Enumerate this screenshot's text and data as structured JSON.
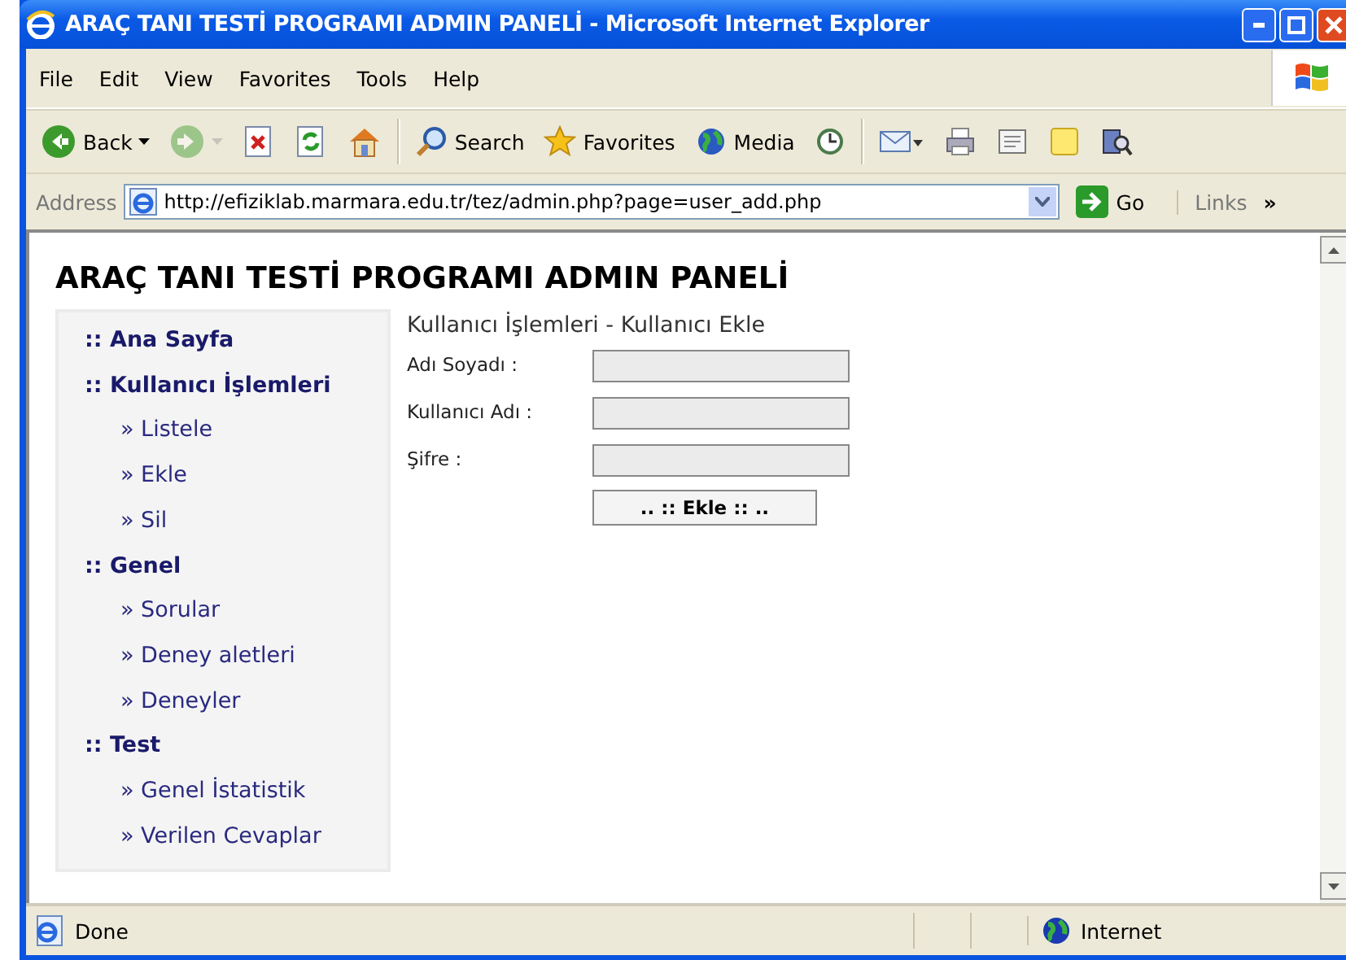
{
  "window": {
    "title": "ARAÇ TANI TESTİ PROGRAMI ADMIN PANELİ - Microsoft Internet Explorer"
  },
  "menu": [
    "File",
    "Edit",
    "View",
    "Favorites",
    "Tools",
    "Help"
  ],
  "toolbar": [
    {
      "kind": "back",
      "label": "Back",
      "disabled": false
    },
    {
      "kind": "forward",
      "disabled": true
    },
    {
      "kind": "stop",
      "disabled": false
    },
    {
      "kind": "refresh",
      "disabled": false
    },
    {
      "kind": "home",
      "disabled": false
    },
    {
      "kind": "search",
      "label": "Search",
      "disabled": false
    },
    {
      "kind": "favorites",
      "label": "Favorites",
      "disabled": false
    },
    {
      "kind": "media",
      "label": "Media",
      "disabled": false
    },
    {
      "kind": "history",
      "disabled": false
    },
    {
      "kind": "mail",
      "disabled": false
    },
    {
      "kind": "print",
      "disabled": false
    },
    {
      "kind": "edit",
      "disabled": false
    },
    {
      "kind": "note",
      "disabled": false
    },
    {
      "kind": "research",
      "disabled": false
    }
  ],
  "address": {
    "label": "Address",
    "url": "http://efiziklab.marmara.edu.tr/tez/admin.php?page=user_add.php",
    "go": "Go",
    "links": "Links",
    "more": "»"
  },
  "page": {
    "heading": "ARAÇ TANI TESTİ PROGRAMI ADMIN PANELİ",
    "nav": [
      {
        "label": ":: Ana Sayfa"
      },
      {
        "label": ":: Kullanıcı İşlemleri",
        "children": [
          {
            "label": "» Listele"
          },
          {
            "label": "» Ekle"
          },
          {
            "label": "» Sil"
          }
        ]
      },
      {
        "label": ":: Genel",
        "children": [
          {
            "label": "» Sorular"
          },
          {
            "label": "» Deney aletleri"
          },
          {
            "label": "» Deneyler"
          }
        ]
      },
      {
        "label": ":: Test",
        "children": [
          {
            "label": "» Genel İstatistik"
          },
          {
            "label": "» Verilen Cevaplar"
          }
        ]
      }
    ],
    "breadcrumb": "Kullanıcı İşlemleri - Kullanıcı Ekle",
    "form": {
      "fields": [
        {
          "label": "Adı Soyadı :"
        },
        {
          "label": "Kullanıcı Adı :"
        },
        {
          "label": "Şifre :"
        }
      ],
      "submit": ".. :: Ekle :: .."
    }
  },
  "status": {
    "text": "Done",
    "zone": "Internet"
  }
}
